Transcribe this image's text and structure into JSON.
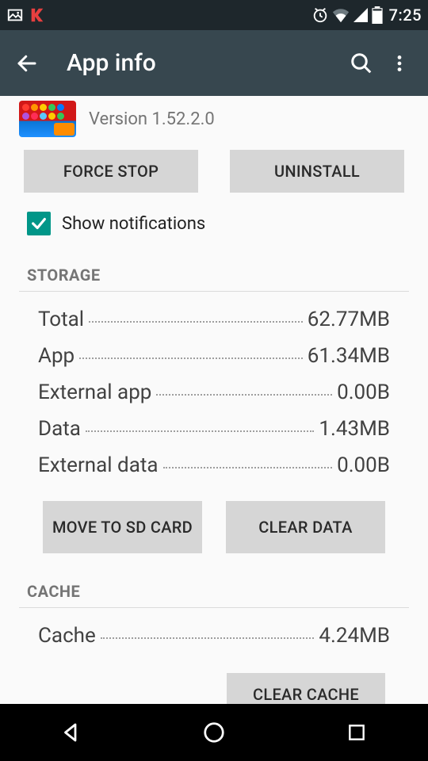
{
  "status": {
    "time": "7:25"
  },
  "appbar": {
    "title": "App info"
  },
  "app": {
    "version": "Version 1.52.2.0"
  },
  "buttons": {
    "force_stop": "FORCE STOP",
    "uninstall": "UNINSTALL",
    "move_to_sd": "MOVE TO SD CARD",
    "clear_data": "CLEAR DATA",
    "clear_cache": "CLEAR CACHE"
  },
  "notifications": {
    "checked": true,
    "label": "Show notifications"
  },
  "sections": {
    "storage": "STORAGE",
    "cache": "CACHE"
  },
  "storage": {
    "total_label": "Total",
    "total_value": "62.77MB",
    "app_label": "App",
    "app_value": "61.34MB",
    "ext_app_label": "External app",
    "ext_app_value": "0.00B",
    "data_label": "Data",
    "data_value": "1.43MB",
    "ext_data_label": "External data",
    "ext_data_value": "0.00B"
  },
  "cache": {
    "label": "Cache",
    "value": "4.24MB"
  },
  "colors": {
    "accent": "#009688",
    "appbar": "#37474f",
    "statusbar": "#1e272c",
    "button": "#d6d6d6"
  }
}
